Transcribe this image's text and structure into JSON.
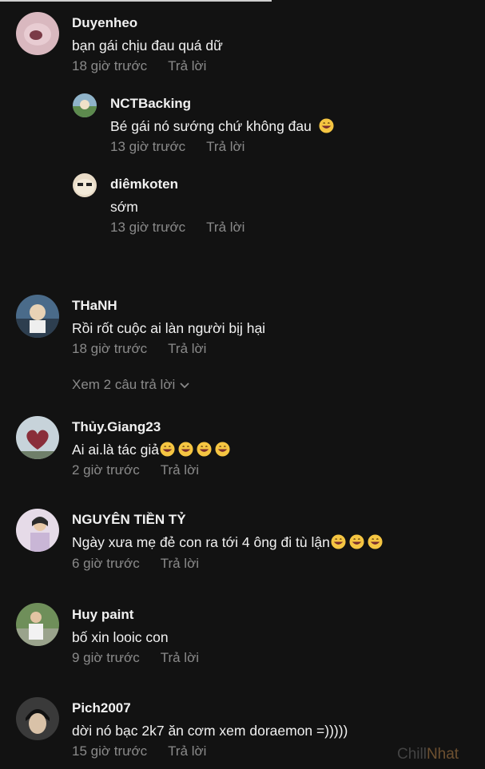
{
  "reply_label": "Trả lời",
  "comments": [
    {
      "author": "Duyenheo",
      "text": "bạn gái chịu đau quá dữ",
      "time": "18 giờ trước"
    },
    {
      "author": "NCTBacking",
      "text": "Bé gái nó sướng chứ không đau",
      "time": "13 giờ trước"
    },
    {
      "author": "diêmkoten",
      "text": "sớm",
      "time": "13 giờ trước"
    },
    {
      "author": "THaNH",
      "text": "Rồi rốt cuộc ai làn người bịj hại",
      "time": "18 giờ trước"
    },
    {
      "author": "Thủy.Giang23",
      "text": "Ai ai.là tác giả",
      "time": "2 giờ trước"
    },
    {
      "author": "NGUYÊN TIỀN TỶ",
      "text": "Ngày xưa mẹ đẻ con ra tới 4 ông đi tù lận",
      "time": "6 giờ trước"
    },
    {
      "author": "Huy paint",
      "text": "bố xin looic con",
      "time": "9 giờ trước"
    },
    {
      "author": "Pich2007",
      "text": "dời nó bạc 2k7 ăn cơm xem doraemon =)))))",
      "time": "15 giờ trước"
    }
  ],
  "view_replies": "Xem 2 câu trả lời",
  "watermark": {
    "part1": "Chill",
    "part2": "Nhat"
  },
  "colors": {
    "background": "#121212",
    "text": "#f1f1f1",
    "muted": "#8a8a8a",
    "emoji": "#f5c542"
  }
}
